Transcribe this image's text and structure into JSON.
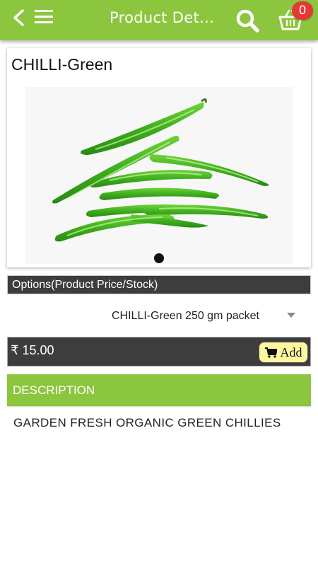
{
  "header": {
    "title": "Product Det…",
    "back_icon": "chevron-left-icon",
    "menu_icon": "hamburger-menu-icon",
    "search_icon": "search-icon",
    "cart_icon": "basket-icon",
    "cart_count": "0"
  },
  "product": {
    "name": "CHILLI-Green",
    "image": "green-chillies-image"
  },
  "options": {
    "label": "Options(Product Price/Stock)",
    "selected": "CHILLI-Green 250 gm packet"
  },
  "price": {
    "amount": "₹ 15.00",
    "add_label": "Add"
  },
  "description": {
    "heading": "DESCRIPTION",
    "text": "GARDEN FRESH ORGANIC GREEN CHILLIES"
  },
  "colors": {
    "brand_green": "#8cc63e",
    "dark_bar": "#3d3d3d",
    "badge_red": "#e53935",
    "add_button": "#fdf8a0"
  }
}
